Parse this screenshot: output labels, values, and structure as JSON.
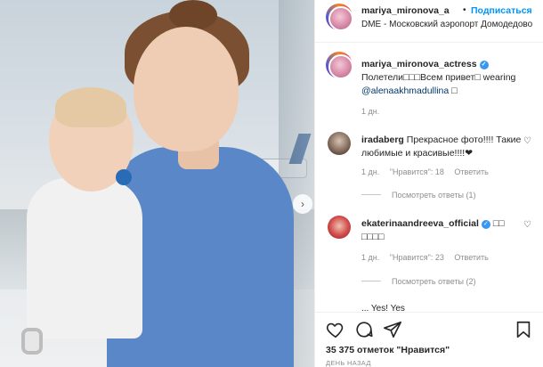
{
  "post": {
    "username": "mariya_mironova_a",
    "follow_label": "Подписаться",
    "location": "DME - Московский аэропорт Домодедово"
  },
  "caption": {
    "username": "mariya_mironova_actress",
    "text": "Полетели□□□Всем привет□ wearing",
    "mention": "@alenaakhmadullina",
    "tail": " □",
    "time": "1 дн."
  },
  "comments": [
    {
      "username": "iradaberg",
      "text": "Прекрасное фото!!!! Такие любимые и красивые!!!!❤",
      "time": "1 дн.",
      "likes": "\"Нравится\": 18",
      "reply_label": "Ответить",
      "view_replies": "Посмотреть ответы (1)"
    },
    {
      "username": "ekaterinaandreeva_official",
      "text": "□□ □□□□",
      "time": "1 дн.",
      "likes": "\"Нравится\": 23",
      "reply_label": "Ответить",
      "view_replies": "Посмотреть ответы (2)"
    }
  ],
  "partial_comment": "... Yes! Yes",
  "likes_count": "35 375 отметок \"Нравится\"",
  "timestamp": "ДЕНЬ НАЗАД",
  "colors": {
    "link": "#0095f6",
    "verified": "#3897f0",
    "muted": "#8e8e8e"
  }
}
